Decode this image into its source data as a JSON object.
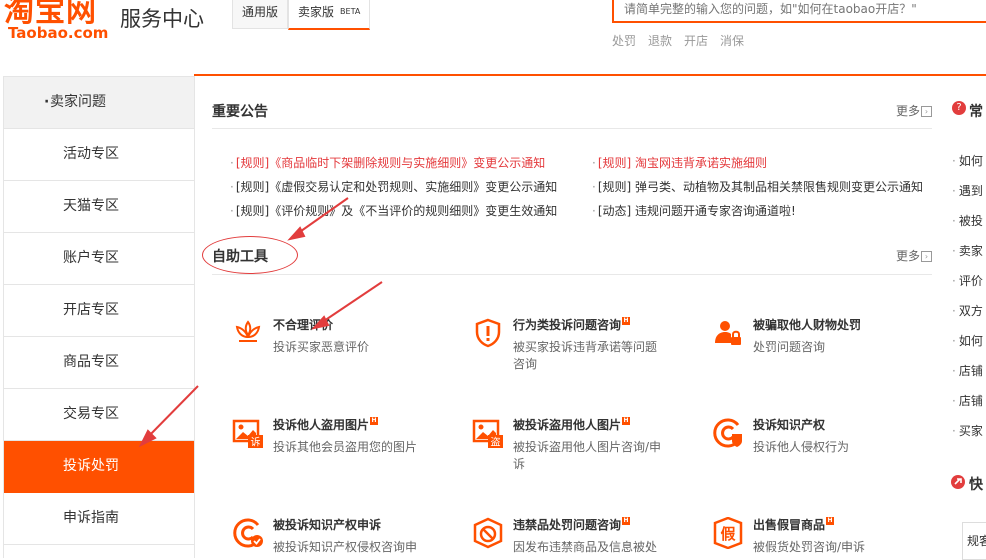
{
  "header": {
    "logo_cn": "淘宝网",
    "logo_en": "Taobao.com",
    "site_title": "服务中心",
    "version_tabs": [
      {
        "label": "通用版",
        "badge": ""
      },
      {
        "label": "卖家版",
        "badge": "BETA"
      }
    ],
    "search": {
      "placeholder": "请简单完整的输入您的问题，如\"如何在taobao开店？\""
    },
    "hot_words": [
      "处罚",
      "退款",
      "开店",
      "消保"
    ]
  },
  "sidebar": {
    "heading": "卖家问题",
    "heading_dot": "·",
    "items": [
      {
        "label": "活动专区"
      },
      {
        "label": "天猫专区"
      },
      {
        "label": "账户专区"
      },
      {
        "label": "开店专区"
      },
      {
        "label": "商品专区"
      },
      {
        "label": "交易专区"
      },
      {
        "label": "投诉处罚"
      },
      {
        "label": "申诉指南"
      }
    ],
    "active_index": 6
  },
  "announcements": {
    "title": "重要公告",
    "more": "更多",
    "left": [
      {
        "text": "[规则]《商品临时下架删除规则与实施细则》变更公示通知",
        "color": "#e4393c"
      },
      {
        "text": "[规则]《虚假交易认定和处罚规则、实施细则》变更公示通知",
        "color": "#333333"
      },
      {
        "text": "[规则]《评价规则》及《不当评价的规则细则》变更生效通知",
        "color": "#333333"
      }
    ],
    "right": [
      {
        "text": "[规则] 淘宝网违背承诺实施细则",
        "color": "#e4393c"
      },
      {
        "text": "[规则] 弹弓类、动植物及其制品相关禁限售规则变更公示通知",
        "color": "#333333"
      },
      {
        "text": "[动态] 违规问题开通专家咨询通道啦!",
        "color": "#333333"
      }
    ]
  },
  "tools": {
    "title": "自助工具",
    "more": "更多",
    "items": [
      {
        "icon": "lotus-icon",
        "title": "不合理评价",
        "hot": false,
        "desc": "投诉买家恶意评价"
      },
      {
        "icon": "warning-shield-icon",
        "title": "行为类投诉问题咨询",
        "hot": true,
        "desc": "被买家投诉违背承诺等问题咨询"
      },
      {
        "icon": "user-lock-icon",
        "title": "被骗取他人财物处罚",
        "hot": false,
        "desc": "处罚问题咨询"
      },
      {
        "icon": "image-complaint-icon",
        "title": "投诉他人盗用图片",
        "hot": true,
        "desc": "投诉其他会员盗用您的图片",
        "badge": "诉"
      },
      {
        "icon": "image-stolen-icon",
        "title": "被投诉盗用他人图片",
        "hot": true,
        "desc": "被投诉盗用他人图片咨询/申诉",
        "badge": "盗"
      },
      {
        "icon": "copyright-icon",
        "title": "投诉知识产权",
        "hot": false,
        "desc": "投诉他人侵权行为"
      },
      {
        "icon": "copyright-appeal-icon",
        "title": "被投诉知识产权申诉",
        "hot": false,
        "desc": "被投诉知识产权侵权咨询申"
      },
      {
        "icon": "prohibited-box-icon",
        "title": "违禁品处罚问题咨询",
        "hot": true,
        "desc": "因发布违禁商品及信息被处"
      },
      {
        "icon": "fake-product-icon",
        "title": "出售假冒商品",
        "hot": true,
        "desc": "被假货处罚咨询/申诉",
        "badge": "假"
      }
    ]
  },
  "right_panel": {
    "title": "常",
    "question_mark": "?",
    "items": [
      "如何",
      "遇到",
      "被投",
      "卖家",
      "评价",
      "双方",
      "如何",
      "店铺",
      "店铺",
      "买家"
    ],
    "section2_title": "快",
    "box_label": "规客"
  },
  "colors": {
    "accent": "#ff5000",
    "notice_red": "#e4393c",
    "annotation_red": "#e23d3d"
  }
}
